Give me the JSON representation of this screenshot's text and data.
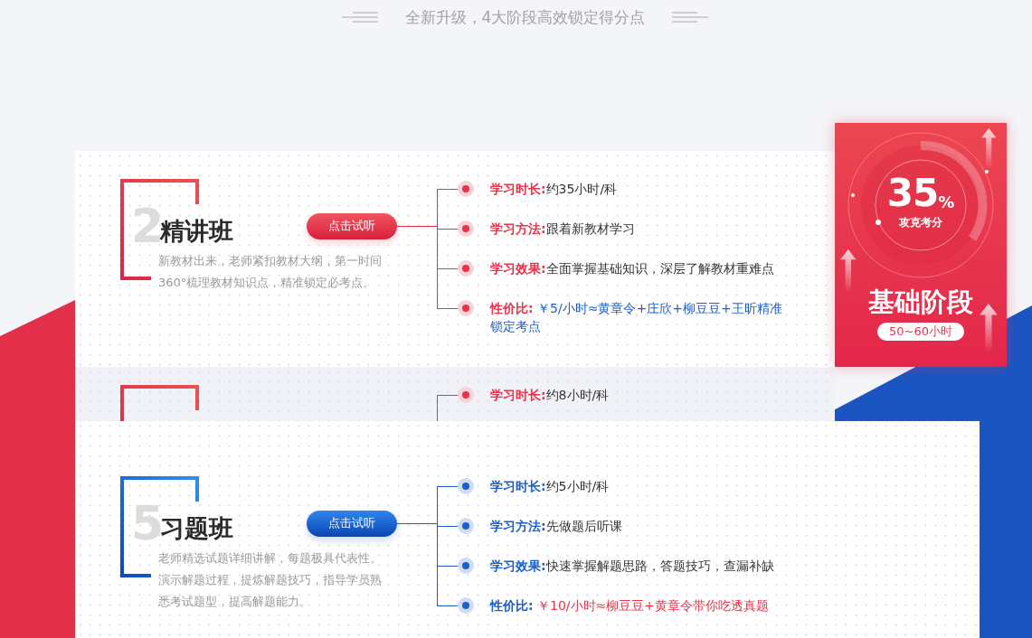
{
  "heading": "全新升级，4大阶段高效锁定得分点",
  "courses": [
    {
      "kind": "full",
      "color": "#e8334a",
      "number": "2",
      "title": "精讲班",
      "description": "新教材出来，老师紧扣教材大纲，第一时间360°梳理教材知识点，精准锁定必考点。",
      "button": "点击试听",
      "details": [
        {
          "kind": "plain",
          "label": "学习时长:",
          "value": "约35小时/科"
        },
        {
          "kind": "plain",
          "label": "学习方法:",
          "value": "跟着新教材学习"
        },
        {
          "kind": "plain",
          "label": "学习效果:",
          "value": "全面掌握基础知识，深层了解教材重难点"
        },
        {
          "kind": "price",
          "label": "性价比:",
          "value": " ￥5/小时≈黄章令+庄欣+柳豆豆+王昕精准锁定考点"
        }
      ]
    },
    {
      "kind": "partial",
      "color": "#e8334a",
      "details": [
        {
          "kind": "plain",
          "label": "学习时长:",
          "value": "约8小时/科"
        }
      ]
    },
    {
      "kind": "full",
      "color": "#1d5fc7",
      "number": "5",
      "title": "习题班",
      "description": "老师精选试题详细讲解，每题极具代表性。演示解题过程，提炼解题技巧，指导学员熟悉考试题型，提高解题能力。",
      "button": "点击试听",
      "details": [
        {
          "kind": "plain",
          "label": "学习时长:",
          "value": "约5小时/科"
        },
        {
          "kind": "plain",
          "label": "学习方法:",
          "value": "先做题后听课"
        },
        {
          "kind": "plain",
          "label": "学习效果:",
          "value": "快速掌握解题思路，答题技巧，查漏补缺"
        },
        {
          "kind": "price",
          "label": "性价比:",
          "value": " ￥10/小时≈柳豆豆+黄章令带你吃透真题"
        }
      ]
    }
  ],
  "stage_badge": {
    "percent": "35",
    "percent_sign": "%",
    "caption": "攻克考分",
    "stage": "基础阶段",
    "hours": "50~60小时"
  }
}
